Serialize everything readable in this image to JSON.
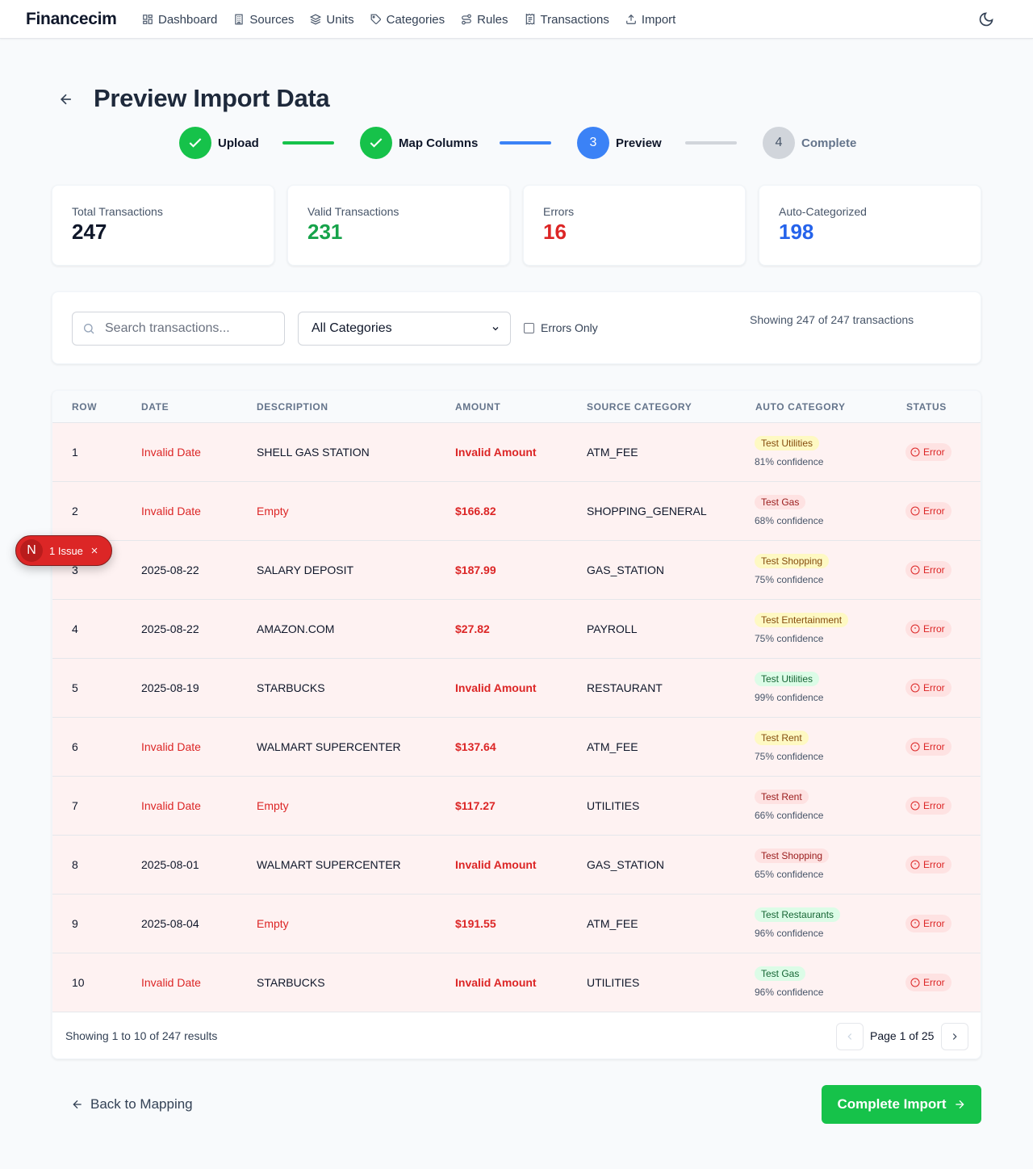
{
  "app": {
    "brand": "Financecim"
  },
  "nav": [
    {
      "label": "Dashboard",
      "icon": "dashboard-icon"
    },
    {
      "label": "Sources",
      "icon": "building-icon"
    },
    {
      "label": "Units",
      "icon": "layers-icon"
    },
    {
      "label": "Categories",
      "icon": "tag-icon"
    },
    {
      "label": "Rules",
      "icon": "route-icon"
    },
    {
      "label": "Transactions",
      "icon": "receipt-icon"
    },
    {
      "label": "Import",
      "icon": "upload-icon"
    }
  ],
  "page": {
    "title": "Preview Import Data"
  },
  "steps": [
    {
      "label": "Upload",
      "state": "done"
    },
    {
      "label": "Map Columns",
      "state": "done"
    },
    {
      "label": "Preview",
      "number": "3",
      "state": "current"
    },
    {
      "label": "Complete",
      "number": "4",
      "state": "pending"
    }
  ],
  "stats": [
    {
      "label": "Total Transactions",
      "value": "247",
      "color": "#0f172a"
    },
    {
      "label": "Valid Transactions",
      "value": "231",
      "color": "#16a34a"
    },
    {
      "label": "Errors",
      "value": "16",
      "color": "#dc2626"
    },
    {
      "label": "Auto-Categorized",
      "value": "198",
      "color": "#2563eb"
    }
  ],
  "filters": {
    "search_placeholder": "Search transactions...",
    "category_selected": "All Categories",
    "errors_only_label": "Errors Only",
    "showing": "Showing 247 of 247 transactions"
  },
  "table": {
    "columns": [
      "ROW",
      "DATE",
      "DESCRIPTION",
      "AMOUNT",
      "SOURCE CATEGORY",
      "AUTO CATEGORY",
      "STATUS"
    ],
    "rows": [
      {
        "row": "1",
        "date": "Invalid Date",
        "date_error": true,
        "description": "SHELL GAS STATION",
        "desc_error": false,
        "amount": "Invalid Amount",
        "source_category": "ATM_FEE",
        "auto_category": "Test Utilities",
        "badge": "yellow",
        "confidence": "81% confidence",
        "status": "Error"
      },
      {
        "row": "2",
        "date": "Invalid Date",
        "date_error": true,
        "description": "Empty",
        "desc_error": true,
        "amount": "$166.82",
        "source_category": "SHOPPING_GENERAL",
        "auto_category": "Test Gas",
        "badge": "red",
        "confidence": "68% confidence",
        "status": "Error"
      },
      {
        "row": "3",
        "date": "2025-08-22",
        "date_error": false,
        "description": "SALARY DEPOSIT",
        "desc_error": false,
        "amount": "$187.99",
        "source_category": "GAS_STATION",
        "auto_category": "Test Shopping",
        "badge": "yellow",
        "confidence": "75% confidence",
        "status": "Error"
      },
      {
        "row": "4",
        "date": "2025-08-22",
        "date_error": false,
        "description": "AMAZON.COM",
        "desc_error": false,
        "amount": "$27.82",
        "source_category": "PAYROLL",
        "auto_category": "Test Entertainment",
        "badge": "yellow",
        "confidence": "75% confidence",
        "status": "Error"
      },
      {
        "row": "5",
        "date": "2025-08-19",
        "date_error": false,
        "description": "STARBUCKS",
        "desc_error": false,
        "amount": "Invalid Amount",
        "source_category": "RESTAURANT",
        "auto_category": "Test Utilities",
        "badge": "green",
        "confidence": "99% confidence",
        "status": "Error"
      },
      {
        "row": "6",
        "date": "Invalid Date",
        "date_error": true,
        "description": "WALMART SUPERCENTER",
        "desc_error": false,
        "amount": "$137.64",
        "source_category": "ATM_FEE",
        "auto_category": "Test Rent",
        "badge": "yellow",
        "confidence": "75% confidence",
        "status": "Error"
      },
      {
        "row": "7",
        "date": "Invalid Date",
        "date_error": true,
        "description": "Empty",
        "desc_error": true,
        "amount": "$117.27",
        "source_category": "UTILITIES",
        "auto_category": "Test Rent",
        "badge": "red",
        "confidence": "66% confidence",
        "status": "Error"
      },
      {
        "row": "8",
        "date": "2025-08-01",
        "date_error": false,
        "description": "WALMART SUPERCENTER",
        "desc_error": false,
        "amount": "Invalid Amount",
        "source_category": "GAS_STATION",
        "auto_category": "Test Shopping",
        "badge": "red",
        "confidence": "65% confidence",
        "status": "Error"
      },
      {
        "row": "9",
        "date": "2025-08-04",
        "date_error": false,
        "description": "Empty",
        "desc_error": true,
        "amount": "$191.55",
        "source_category": "ATM_FEE",
        "auto_category": "Test Restaurants",
        "badge": "green",
        "confidence": "96% confidence",
        "status": "Error"
      },
      {
        "row": "10",
        "date": "Invalid Date",
        "date_error": true,
        "description": "STARBUCKS",
        "desc_error": false,
        "amount": "Invalid Amount",
        "source_category": "UTILITIES",
        "auto_category": "Test Gas",
        "badge": "green",
        "confidence": "96% confidence",
        "status": "Error"
      }
    ],
    "footer": {
      "results": "Showing 1 to 10 of 247 results",
      "page": "Page 1 of 25"
    }
  },
  "actions": {
    "back_label": "Back to Mapping",
    "complete_label": "Complete Import"
  },
  "dev_overlay": {
    "logo": "N",
    "label": "1 Issue"
  },
  "colors": {
    "success": "#16c24a",
    "primary": "#3b82f6",
    "error": "#dc2626",
    "badge_yellow_bg": "#fef9c3",
    "badge_yellow_fg": "#854d0e",
    "badge_red_bg": "#fee2e2",
    "badge_red_fg": "#991b1b",
    "badge_green_bg": "#dcfce7",
    "badge_green_fg": "#166534"
  }
}
